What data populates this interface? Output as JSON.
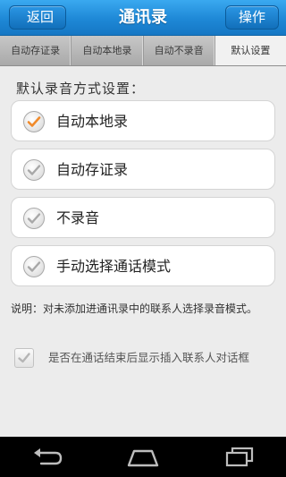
{
  "header": {
    "back_label": "返回",
    "title": "通讯录",
    "action_label": "操作"
  },
  "tabs": [
    {
      "label": "自动存证录",
      "active": false
    },
    {
      "label": "自动本地录",
      "active": false
    },
    {
      "label": "自动不录音",
      "active": false
    },
    {
      "label": "默认设置",
      "active": true
    }
  ],
  "settings": {
    "section_title": "默认录音方式设置：",
    "options": [
      {
        "label": "自动本地录",
        "selected": true
      },
      {
        "label": "自动存证录",
        "selected": false
      },
      {
        "label": "不录音",
        "selected": false
      },
      {
        "label": "手动选择通话模式",
        "selected": false
      }
    ],
    "note": "说明：对未添加进通讯录中的联系人选择录音模式。",
    "prompt_checkbox": {
      "label": "是否在通话结束后显示插入联系人对话框",
      "checked": true
    }
  },
  "colors": {
    "titlebar": "#1e88d6",
    "selected_check": "#f08a2a",
    "unselected_check": "#9a9a9a"
  },
  "icons": {
    "nav_back": "back-arrow-icon",
    "nav_home": "home-icon",
    "nav_recent": "recent-apps-icon"
  }
}
